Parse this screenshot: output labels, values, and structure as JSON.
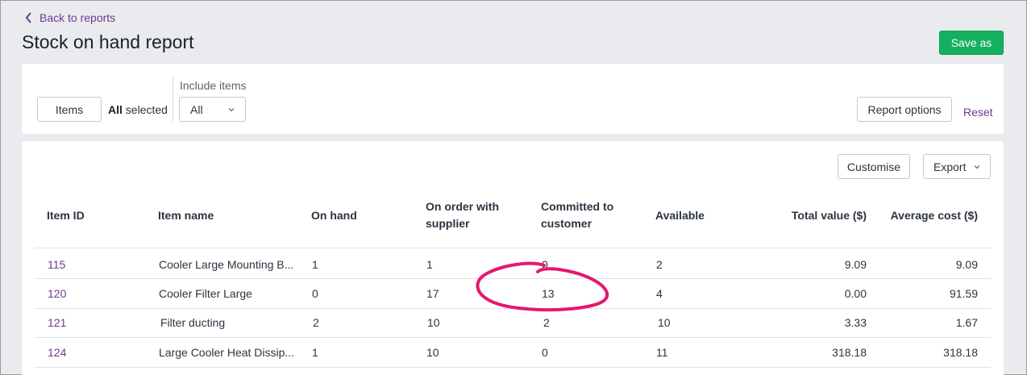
{
  "header": {
    "back_label": "Back to reports",
    "title": "Stock on hand report",
    "save_label": "Save as"
  },
  "filters": {
    "items_button": "Items",
    "all_bold": "All",
    "selected_text": "selected",
    "include_label": "Include items",
    "include_value": "All",
    "report_options": "Report options",
    "reset": "Reset"
  },
  "toolbar": {
    "customise": "Customise",
    "export": "Export"
  },
  "table": {
    "columns": {
      "item_id": "Item ID",
      "item_name": "Item name",
      "on_hand": "On hand",
      "on_order_1": "On order with",
      "on_order_2": "supplier",
      "committed_1": "Committed to",
      "committed_2": "customer",
      "available": "Available",
      "total_value": "Total value ($)",
      "avg_cost": "Average cost ($)"
    },
    "rows": [
      {
        "id": "115",
        "name": "Cooler Large Mounting B...",
        "on_hand": "1",
        "on_order": "1",
        "committed": "0",
        "available": "2",
        "total": "9.09",
        "avg": "9.09"
      },
      {
        "id": "120",
        "name": "Cooler Filter Large",
        "on_hand": "0",
        "on_order": "17",
        "committed": "13",
        "available": "4",
        "total": "0.00",
        "avg": "91.59"
      },
      {
        "id": "121",
        "name": "Filter ducting",
        "on_hand": "2",
        "on_order": "10",
        "committed": "2",
        "available": "10",
        "total": "3.33",
        "avg": "1.67"
      },
      {
        "id": "124",
        "name": "Large Cooler Heat Dissip...",
        "on_hand": "1",
        "on_order": "10",
        "committed": "0",
        "available": "11",
        "total": "318.18",
        "avg": "318.18"
      }
    ]
  },
  "colors": {
    "accent_link": "#6d3b8f",
    "save_green": "#13b05d",
    "annotation": "#e6186f"
  }
}
